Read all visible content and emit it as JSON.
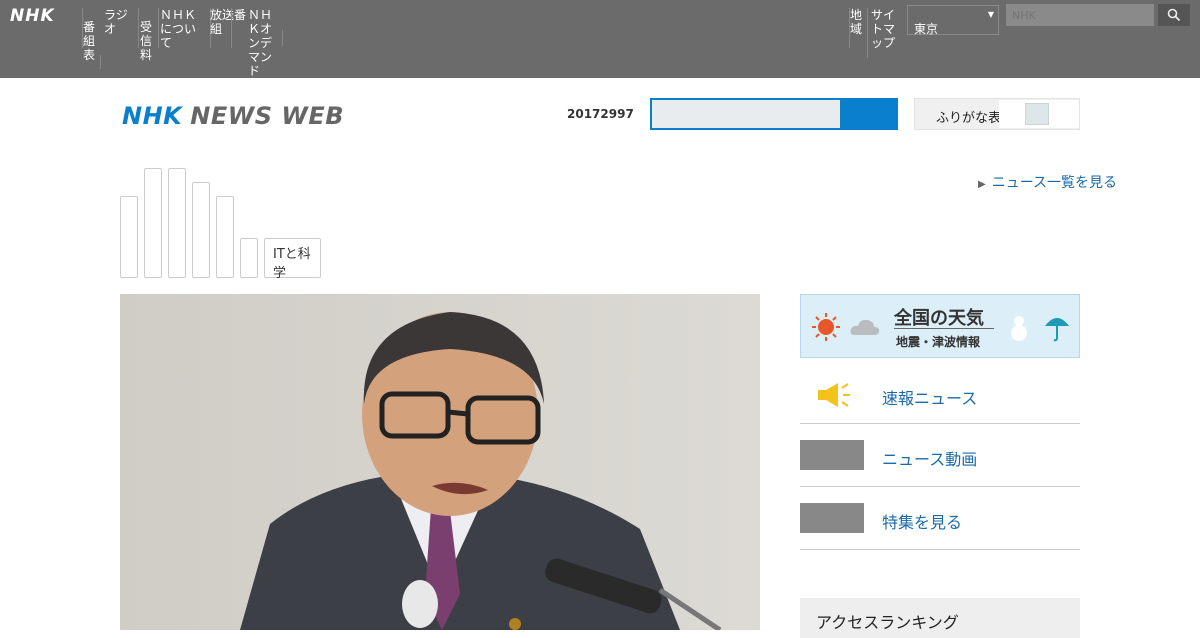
{
  "topbar": {
    "logo": "NHK",
    "nav": [
      "番組表",
      "ラジオ",
      "受信料",
      "ＮＨＫについて",
      "放送番組",
      "ＮＨＫオンデマンド",
      "地域",
      "サイトマップ"
    ],
    "region_label": "地域",
    "region_selected": "東京",
    "search_placeholder": "NHK"
  },
  "header": {
    "brand_nhk": "NHK",
    "brand_rest": "NEWS WEB",
    "date": "20172997",
    "search_value": "",
    "toggle_label": "ふりがな表示"
  },
  "nav": {
    "side_link": "ニュース一覧を見る",
    "tab_it": "ITと科学"
  },
  "sidebar": {
    "weather_title": "全国の天気",
    "weather_sub": "地震・津波情報",
    "items": [
      {
        "label": "速報ニュース"
      },
      {
        "label": "ニュース動画"
      },
      {
        "label": "特集を見る"
      }
    ],
    "ranking_label": "アクセスランキング"
  },
  "colors": {
    "accent": "#0a7fcc",
    "topbar": "#6b6b6b",
    "link": "#1a6aa8"
  }
}
